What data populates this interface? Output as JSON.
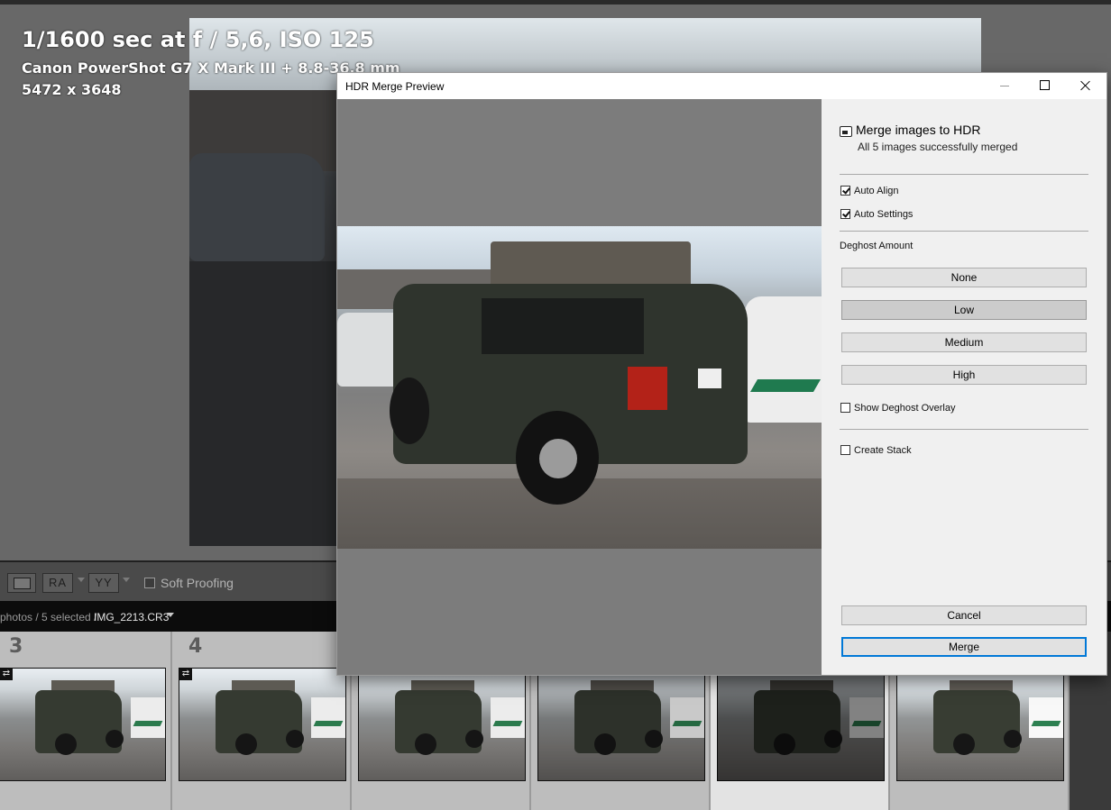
{
  "photo_info": {
    "exposure": "1/1600 sec at f / 5,6, ISO 125",
    "camera": "Canon PowerShot G7 X Mark III + 8.8-36.8 mm",
    "dimensions": "5472 x 3648"
  },
  "toolbar": {
    "view_label": "",
    "ra_label": "RA",
    "yy_label": "YY",
    "soft_proofing_label": "Soft Proofing"
  },
  "pathbar": {
    "path": "photos / 5 selected /",
    "filename": "IMG_2213.CR3"
  },
  "filmstrip": {
    "cells": [
      {
        "number": "3"
      },
      {
        "number": "4"
      },
      {
        "number": ""
      },
      {
        "number": ""
      },
      {
        "number": ""
      },
      {
        "number": ""
      }
    ]
  },
  "dialog": {
    "title": "HDR Merge Preview",
    "heading": "Merge images to HDR",
    "status": "All 5 images successfully merged",
    "auto_align": {
      "label": "Auto Align",
      "checked": true
    },
    "auto_settings": {
      "label": "Auto Settings",
      "checked": true
    },
    "deghost_label": "Deghost Amount",
    "deghost_options": [
      "None",
      "Low",
      "Medium",
      "High"
    ],
    "deghost_selected": "Low",
    "show_overlay": {
      "label": "Show Deghost Overlay",
      "checked": false
    },
    "create_stack": {
      "label": "Create Stack",
      "checked": false
    },
    "cancel_label": "Cancel",
    "merge_label": "Merge",
    "accent_color": "#0078d7"
  }
}
